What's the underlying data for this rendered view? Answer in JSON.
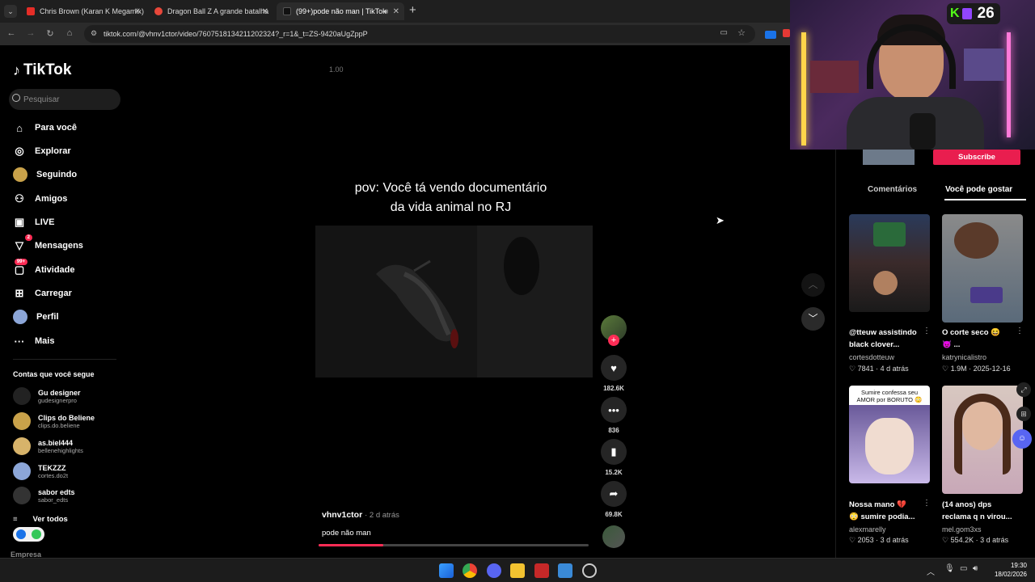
{
  "browser": {
    "tabs": [
      {
        "title": "Chris Brown (Karan K Megamix)",
        "color": "#e52d27",
        "active": false
      },
      {
        "title": "Dragon Ball Z A grande batalha",
        "color": "#e8473a",
        "active": false
      },
      {
        "title": "(99+)pode não man | TikTok",
        "color": "#ffffff",
        "active": true
      }
    ],
    "new_tab": "+",
    "url": "tiktok.com/@vhnv1ctor/video/7607518134211202324?_r=1&_t=ZS-9420aUgZppP"
  },
  "sidebar": {
    "brand": "TikTok",
    "search_placeholder": "Pesquisar",
    "nav": [
      {
        "label": "Para você",
        "icon": "home-icon"
      },
      {
        "label": "Explorar",
        "icon": "compass-icon"
      },
      {
        "label": "Seguindo",
        "icon": "following-avatar-icon"
      },
      {
        "label": "Amigos",
        "icon": "friends-icon"
      },
      {
        "label": "LIVE",
        "icon": "live-icon"
      },
      {
        "label": "Mensagens",
        "icon": "messages-icon",
        "badge": "2"
      },
      {
        "label": "Atividade",
        "icon": "activity-icon",
        "badge": "99+"
      },
      {
        "label": "Carregar",
        "icon": "upload-icon"
      },
      {
        "label": "Perfil",
        "icon": "profile-avatar-icon"
      },
      {
        "label": "Mais",
        "icon": "more-icon"
      }
    ],
    "following_title": "Contas que você segue",
    "following": [
      {
        "name": "Gu designer",
        "handle": "gudesignerpro",
        "color": "#222"
      },
      {
        "name": "Clips do Beliene",
        "handle": "clips.do.beliene",
        "color": "#c9a24a"
      },
      {
        "name": "as.biel444",
        "handle": "bellenehighlights",
        "color": "#d7b36a"
      },
      {
        "name": "TEKZZZ",
        "handle": "cortes.do2t",
        "color": "#8ca6d8"
      },
      {
        "name": "sabor edts",
        "handle": "sabor_edts",
        "color": "#333"
      }
    ],
    "see_all": "Ver todos",
    "footer_label": "Empresa"
  },
  "video": {
    "speed": "1.00",
    "caption_line1": "pov: Você tá vendo documentário",
    "caption_line2": "da vida animal no RJ",
    "author": "vhnv1ctor",
    "time": "· 2 d atrás",
    "description": "pode não man",
    "progress": 0.24,
    "likes": "182.6K",
    "comments": "836",
    "saves": "15.2K",
    "shares": "69.8K"
  },
  "right_panel": {
    "subscribe": "Subscribe",
    "tabs": [
      "Comentários",
      "Você pode gostar"
    ],
    "cards": [
      {
        "title1": "@tteuw assistindo",
        "title2": "black clover...",
        "author": "cortesdotteuw",
        "likes": "7841",
        "time": "4 d atrás"
      },
      {
        "title1": "O corte seco 😆",
        "title2": "😈 ...",
        "author": "katrynicalistro",
        "likes": "1.9M",
        "time": "2025-12-16"
      },
      {
        "title1": "Nossa mano 💔",
        "title2": "😳 sumire podia...",
        "author": "alexmarelly",
        "likes": "2053",
        "time": "3 d atrás",
        "overlay": "Sumire confessa seu AMOR por BORUTO 😳"
      },
      {
        "title1": "(14 anos) dps",
        "title2": "reclama q n virou...",
        "author": "mel.gom3xs",
        "likes": "554.2K",
        "time": "3 d atrás"
      }
    ]
  },
  "webcam": {
    "viewer_count": "26"
  },
  "taskbar": {
    "time": "19:30",
    "date": "18/02/2026"
  },
  "colors": {
    "accent": "#fe2c55",
    "subscribe": "#e91e4f"
  }
}
